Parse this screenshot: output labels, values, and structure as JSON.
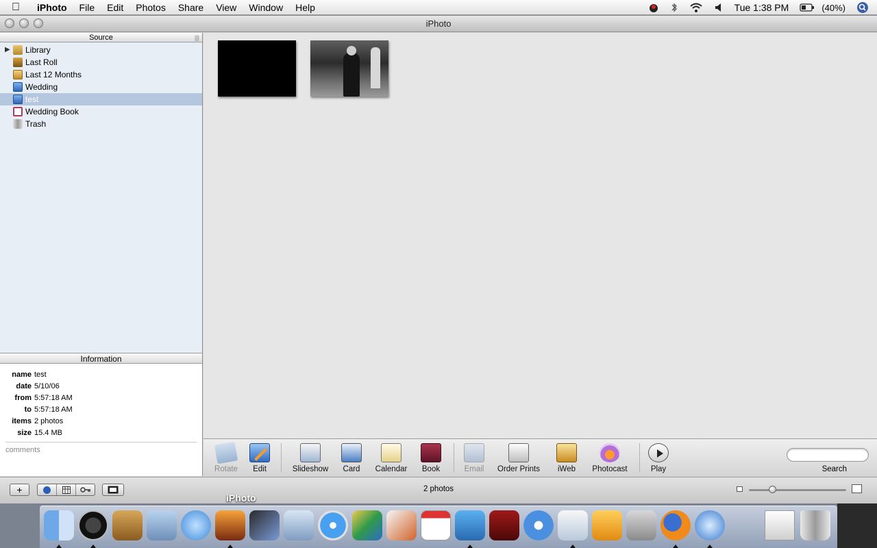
{
  "menubar": {
    "app_name": "iPhoto",
    "menus": [
      "File",
      "Edit",
      "Photos",
      "Share",
      "View",
      "Window",
      "Help"
    ],
    "clock": "Tue 1:38 PM",
    "battery": "(40%)"
  },
  "window": {
    "title": "iPhoto"
  },
  "source": {
    "header": "Source",
    "items": [
      {
        "label": "Library",
        "icon": "library-icon",
        "color": "#c9a24a"
      },
      {
        "label": "Last Roll",
        "icon": "roll-icon",
        "color": "#b8860b"
      },
      {
        "label": "Last 12 Months",
        "icon": "calendar-icon",
        "color": "#d9a441"
      },
      {
        "label": "Wedding",
        "icon": "album-icon",
        "color": "#3d7fd6"
      },
      {
        "label": "test",
        "icon": "album-icon",
        "color": "#3d7fd6"
      },
      {
        "label": "Wedding Book",
        "icon": "book-icon",
        "color": "#b23a5a"
      },
      {
        "label": "Trash",
        "icon": "trash-icon",
        "color": "#8c8c8c"
      }
    ]
  },
  "information": {
    "header": "Information",
    "rows": [
      {
        "key": "name",
        "value": "test"
      },
      {
        "key": "date",
        "value": "5/10/06"
      },
      {
        "key": "from",
        "value": "5:57:18 AM"
      },
      {
        "key": "to",
        "value": "5:57:18 AM"
      },
      {
        "key": "items",
        "value": "2 photos"
      },
      {
        "key": "size",
        "value": "15.4 MB"
      }
    ],
    "comments_placeholder": "comments"
  },
  "toolbar": {
    "rotate": "Rotate",
    "edit": "Edit",
    "slideshow": "Slideshow",
    "card": "Card",
    "calendar": "Calendar",
    "book": "Book",
    "email": "Email",
    "order_prints": "Order Prints",
    "iweb": "iWeb",
    "photocast": "Photocast",
    "play": "Play",
    "search_label": "Search"
  },
  "bottombar": {
    "add_label": "+",
    "photo_count": "2 photos"
  },
  "dock": {
    "hover_label": "iPhoto"
  }
}
